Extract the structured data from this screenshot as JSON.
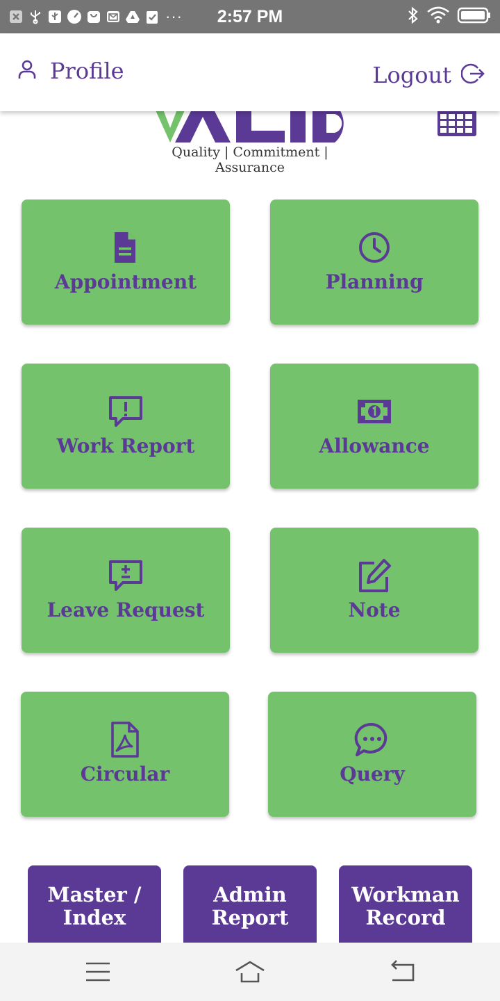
{
  "status_bar": {
    "time": "2:57 PM",
    "more": "···",
    "left_icons": [
      "close-notification-icon",
      "usb-icon",
      "usb-debug-icon",
      "speedometer-icon",
      "shopping-bag-icon",
      "mail-icon",
      "drive-icon",
      "clipboard-check-icon"
    ],
    "right_icons": [
      "bluetooth-icon",
      "wifi-icon",
      "battery-icon"
    ]
  },
  "header": {
    "profile_label": "Profile",
    "logout_label": "Logout"
  },
  "logo": {
    "tagline": "Quality | Commitment | Assurance",
    "brand_color": "#5b3a96",
    "accent_color": "#74c26c"
  },
  "tiles": [
    {
      "label": "Appointment",
      "icon": "document-icon"
    },
    {
      "label": "Planning",
      "icon": "clock-icon"
    },
    {
      "label": "Work Report",
      "icon": "alert-message-icon"
    },
    {
      "label": "Allowance",
      "icon": "money-bill-icon"
    },
    {
      "label": "Leave Request",
      "icon": "plus-minus-message-icon"
    },
    {
      "label": "Note",
      "icon": "edit-note-icon"
    },
    {
      "label": "Circular",
      "icon": "pdf-file-icon"
    },
    {
      "label": "Query",
      "icon": "chat-bubble-icon"
    }
  ],
  "bottom_buttons": [
    {
      "line1": "Master /",
      "line2": "Index"
    },
    {
      "line1": "Admin",
      "line2": "Report"
    },
    {
      "line1": "Workman",
      "line2": "Record"
    }
  ],
  "colors": {
    "tile_green": "#74c26c",
    "purple": "#5b3a96",
    "status_bar_gray": "#757575"
  }
}
